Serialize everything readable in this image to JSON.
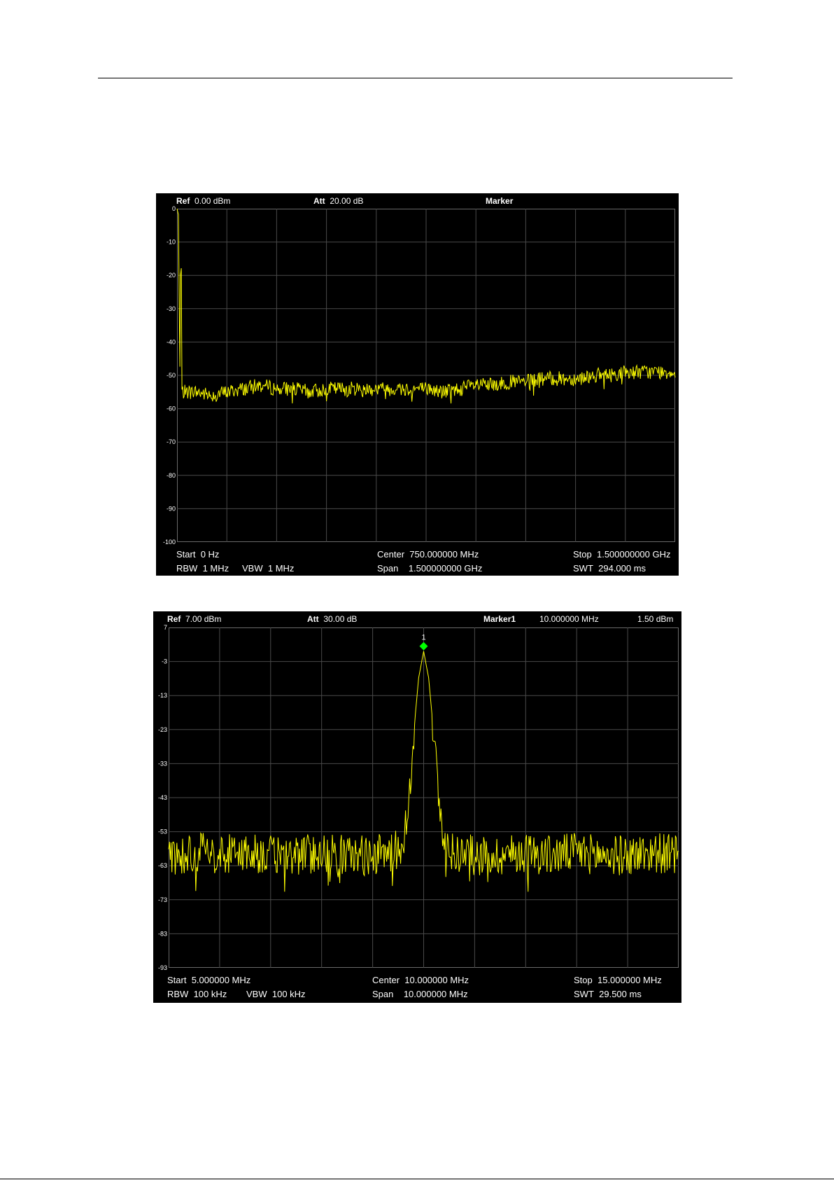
{
  "page": {
    "colors": {
      "trace": "#ffff00",
      "grid": "#4a4a4a",
      "marker": "#00ff00",
      "background": "#000000"
    }
  },
  "chart_data": [
    {
      "type": "line",
      "header": {
        "ref_label": "Ref",
        "ref_value": "0.00 dBm",
        "att_label": "Att",
        "att_value": "20.00 dB",
        "marker_label": "Marker",
        "marker_freq": "",
        "marker_level": ""
      },
      "y_ticks": [
        "0",
        "-10",
        "-20",
        "-30",
        "-40",
        "-50",
        "-60",
        "-70",
        "-80",
        "-90",
        "-100"
      ],
      "ylim": [
        -100,
        0
      ],
      "xlim": [
        0,
        1500
      ],
      "x_unit": "MHz",
      "grid": true,
      "footer": {
        "start_label": "Start",
        "start_value": "0 Hz",
        "center_label": "Center",
        "center_value": "750.000000 MHz",
        "stop_label": "Stop",
        "stop_value": "1.500000000 GHz",
        "rbw_label": "RBW",
        "rbw_value": "1 MHz",
        "vbw_label": "VBW",
        "vbw_value": "1 MHz",
        "span_label": "Span",
        "span_value": "1.500000000 GHz",
        "swt_label": "SWT",
        "swt_value": "294.000 ms"
      },
      "series": [
        {
          "x": [
            0,
            5,
            8,
            12,
            15,
            30,
            60,
            100,
            150,
            200,
            250,
            300,
            350,
            400,
            450,
            500,
            550,
            600,
            650,
            700,
            750,
            800,
            850,
            900,
            950,
            1000,
            1050,
            1100,
            1150,
            1200,
            1250,
            1300,
            1350,
            1400,
            1450,
            1500
          ],
          "y": [
            0,
            -2,
            -55,
            -3,
            -55,
            -55,
            -55,
            -56,
            -55,
            -54,
            -53,
            -54,
            -54,
            -55,
            -54,
            -54,
            -54,
            -54,
            -54,
            -54,
            -54,
            -55,
            -54,
            -53,
            -53,
            -52,
            -52,
            -51,
            -51,
            -51,
            -50,
            -50,
            -49,
            -49,
            -49,
            -49
          ]
        }
      ]
    },
    {
      "type": "line",
      "header": {
        "ref_label": "Ref",
        "ref_value": "7.00 dBm",
        "att_label": "Att",
        "att_value": "30.00 dB",
        "marker_label": "Marker1",
        "marker_freq": "10.000000 MHz",
        "marker_level": "1.50 dBm"
      },
      "y_ticks": [
        "7",
        "-3",
        "-13",
        "-23",
        "-33",
        "-43",
        "-53",
        "-63",
        "-73",
        "-83",
        "-93"
      ],
      "ylim": [
        -93,
        7
      ],
      "xlim": [
        5,
        15
      ],
      "x_unit": "MHz",
      "grid": true,
      "marker": {
        "label": "1",
        "x": 10.0,
        "y": 1.5
      },
      "footer": {
        "start_label": "Start",
        "start_value": "5.000000 MHz",
        "center_label": "Center",
        "center_value": "10.000000 MHz",
        "stop_label": "Stop",
        "stop_value": "15.000000 MHz",
        "rbw_label": "RBW",
        "rbw_value": "100 kHz",
        "vbw_label": "VBW",
        "vbw_value": "100 kHz",
        "span_label": "Span",
        "span_value": "10.000000 MHz",
        "swt_label": "SWT",
        "swt_value": "29.500 ms"
      },
      "series": [
        {
          "x": [
            5.0,
            5.5,
            6.0,
            6.5,
            7.0,
            7.5,
            8.0,
            8.5,
            9.0,
            9.4,
            9.6,
            9.7,
            9.8,
            9.9,
            10.0,
            10.1,
            10.2,
            10.3,
            10.4,
            10.6,
            11.0,
            11.5,
            12.0,
            12.5,
            13.0,
            13.5,
            14.0,
            14.5,
            15.0
          ],
          "y": [
            -60,
            -59,
            -60,
            -59,
            -60,
            -60,
            -59,
            -60,
            -60,
            -59,
            -57,
            -45,
            -25,
            -8,
            0,
            -8,
            -25,
            -45,
            -57,
            -59,
            -60,
            -60,
            -59,
            -60,
            -59,
            -60,
            -60,
            -59,
            -60
          ]
        }
      ]
    }
  ]
}
